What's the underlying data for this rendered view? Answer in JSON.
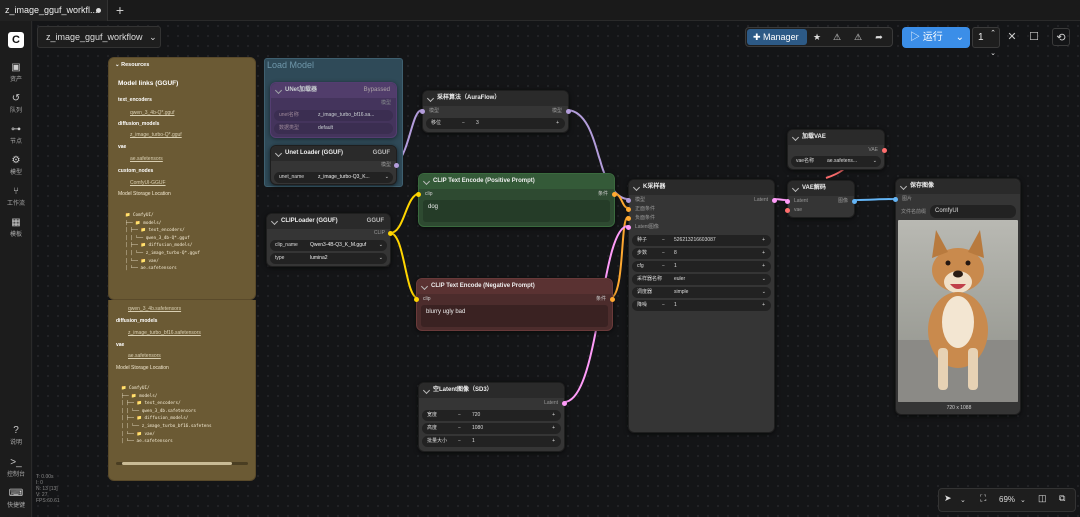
{
  "tab": {
    "title": "z_image_gguf_workfl...",
    "new_tab": "+"
  },
  "workflow_name": "z_image_gguf_workflow",
  "sidebar": [
    {
      "label": "资产",
      "icon": "image-icon"
    },
    {
      "label": "队列",
      "icon": "history-icon"
    },
    {
      "label": "节点",
      "icon": "node-icon"
    },
    {
      "label": "模型",
      "icon": "cube-icon"
    },
    {
      "label": "工作流",
      "icon": "workflow-icon"
    },
    {
      "label": "模板",
      "icon": "template-icon"
    },
    {
      "label": "说明",
      "icon": "help-icon"
    },
    {
      "label": "控制台",
      "icon": "terminal-icon"
    },
    {
      "label": "快捷键",
      "icon": "keyboard-icon"
    }
  ],
  "toolbar": {
    "manager": "Manager",
    "run": "运行",
    "run_count": "1"
  },
  "stats": [
    "T: 0.00s",
    "I: 0",
    "N: 13 [13]",
    "V: 27",
    "FPS:60.61"
  ],
  "bottom": {
    "zoom": "69%"
  },
  "resources": {
    "title": "Resources",
    "heading": "Model links (GGUF)",
    "text_encoders_label": "text_encoders",
    "text_encoder_file": "qwen_3_4b-Q*.gguf",
    "diffusion_label": "diffusion_models",
    "diffusion_file": "z_image_turbo-Q*.gguf",
    "vae_label": "vae",
    "vae_file": "ae.safetensors",
    "custom_label": "custom_nodes",
    "custom_file": "ComfyUI-GGUF",
    "storage_label": "Model Storage Location",
    "tree": [
      "📁 ComfyUI/",
      "├── 📁 models/",
      "│   ├── 📁 text_encoders/",
      "│   │      └── qwen_3_4b-Q*.gguf",
      "│   ├── 📁 diffusion_models/",
      "│   │      └── z_image_turbo-Q*.gguf",
      "│   └── 📁 vae/",
      "│          └── ae.safetensors"
    ],
    "lower_text_encoder": "qwen_3_4b.safetensors",
    "lower_diffusion_label": "diffusion_models",
    "lower_diffusion_file": "z_image_turbo_bf16.safetensors",
    "lower_vae_label": "vae",
    "lower_vae_file": "ae.safetensors",
    "lower_storage_label": "Model Storage Location",
    "lower_tree": [
      "📁 ComfyUI/",
      "├── 📁 models/",
      "│   ├── 📁 text_encoders/",
      "│   │      └── qwen_3_4b.safetensors",
      "│   ├── 📁 diffusion_models/",
      "│   │      └── z_image_turbo_bf16.safetens",
      "│   └── 📁 vae/",
      "│          └── ae.safetensors"
    ]
  },
  "group_title": "Load Model",
  "unet_loader_bg": {
    "title": "UNet加载器",
    "bypass": "Bypassed",
    "output": "模型",
    "row1_label": "unet名称",
    "row1_value": "z_image_turbo_bf16.sa...",
    "row2_label": "数据类型",
    "row2_value": "default"
  },
  "unet_gguf": {
    "title": "Unet Loader (GGUF)",
    "badge": "GGUF",
    "output": "模型",
    "row_label": "unet_name",
    "row_value": "z_image_turbo-Q3_K..."
  },
  "clip_loader": {
    "title": "CLIPLoader (GGUF)",
    "badge": "GGUF",
    "output": "CLIP",
    "row1_label": "clip_name",
    "row1_value": "Qwen3-4B-Q3_K_M.gguf",
    "row2_label": "type",
    "row2_value": "lumina2"
  },
  "sampling": {
    "title": "采样算法（AuraFlow）",
    "input": "模型",
    "output": "模型",
    "row_label": "移位",
    "row_value": "3"
  },
  "pos": {
    "title": "CLIP Text Encode (Positive Prompt)",
    "input": "clip",
    "output": "条件",
    "text": "dog"
  },
  "neg": {
    "title": "CLIP Text Encode (Negative Prompt)",
    "input": "clip",
    "output": "条件",
    "text": "blurry ugly bad"
  },
  "latent": {
    "title": "空Latent图像（SD3）",
    "output": "Latent",
    "rows": [
      {
        "label": "宽度",
        "value": "720"
      },
      {
        "label": "高度",
        "value": "1080"
      },
      {
        "label": "批量大小",
        "value": "1"
      }
    ]
  },
  "ksampler": {
    "title": "K采样器",
    "inputs": [
      "模型",
      "正面条件",
      "负面条件",
      "Latent图像"
    ],
    "output": "Latent",
    "rows": [
      {
        "label": "种子",
        "value": "526213216603087"
      },
      {
        "label": "步数",
        "value": "8"
      },
      {
        "label": "cfg",
        "value": "1"
      },
      {
        "label": "采样器名称",
        "value": "euler"
      },
      {
        "label": "调度器",
        "value": "simple"
      },
      {
        "label": "降噪",
        "value": "1"
      }
    ]
  },
  "vae_loader": {
    "title": "加载VAE",
    "output": "VAE",
    "row_label": "vae名称",
    "row_value": "ae.safetens..."
  },
  "vae_decode": {
    "title": "VAE解码",
    "in1": "Latent",
    "in2": "vae",
    "output": "图像"
  },
  "save": {
    "title": "保存图像",
    "input": "图片",
    "row_label": "文件名前缀",
    "row_value": "ComfyUI",
    "caption": "720 x 1088"
  },
  "colors": {
    "accent": "#3b8ee8",
    "note": "#6b5a34",
    "clip_yellow": "#ffd500",
    "model_lilac": "#b39ddb",
    "cond_orange": "#ffa931",
    "latent_pink": "#ff9cf9",
    "vae_red": "#ff6e6e",
    "image_blue": "#64b5f6"
  }
}
